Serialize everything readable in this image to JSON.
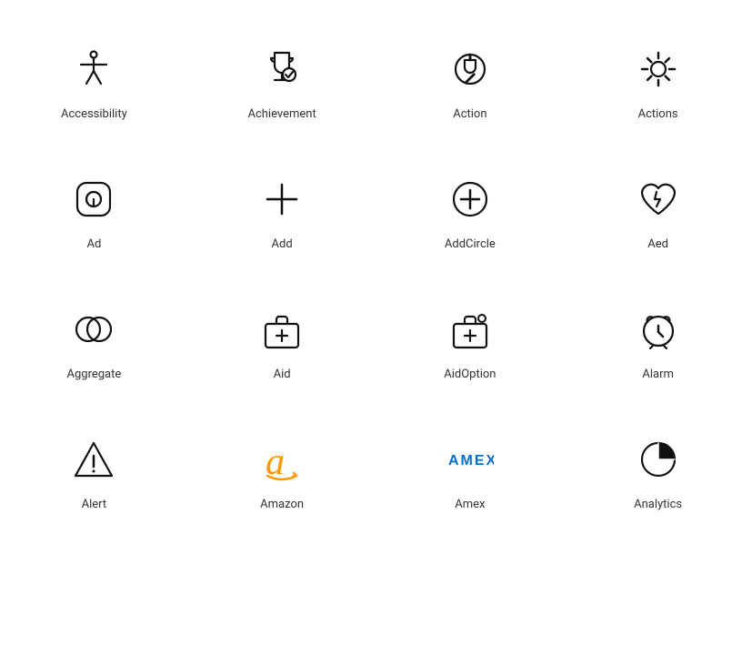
{
  "icons": [
    {
      "name": "Accessibility",
      "id": "accessibility"
    },
    {
      "name": "Achievement",
      "id": "achievement"
    },
    {
      "name": "Action",
      "id": "action"
    },
    {
      "name": "Actions",
      "id": "actions"
    },
    {
      "name": "Ad",
      "id": "ad"
    },
    {
      "name": "Add",
      "id": "add"
    },
    {
      "name": "AddCircle",
      "id": "addcircle"
    },
    {
      "name": "Aed",
      "id": "aed"
    },
    {
      "name": "Aggregate",
      "id": "aggregate"
    },
    {
      "name": "Aid",
      "id": "aid"
    },
    {
      "name": "AidOption",
      "id": "aidoption"
    },
    {
      "name": "Alarm",
      "id": "alarm"
    },
    {
      "name": "Alert",
      "id": "alert"
    },
    {
      "name": "Amazon",
      "id": "amazon"
    },
    {
      "name": "Amex",
      "id": "amex"
    },
    {
      "name": "Analytics",
      "id": "analytics"
    }
  ]
}
